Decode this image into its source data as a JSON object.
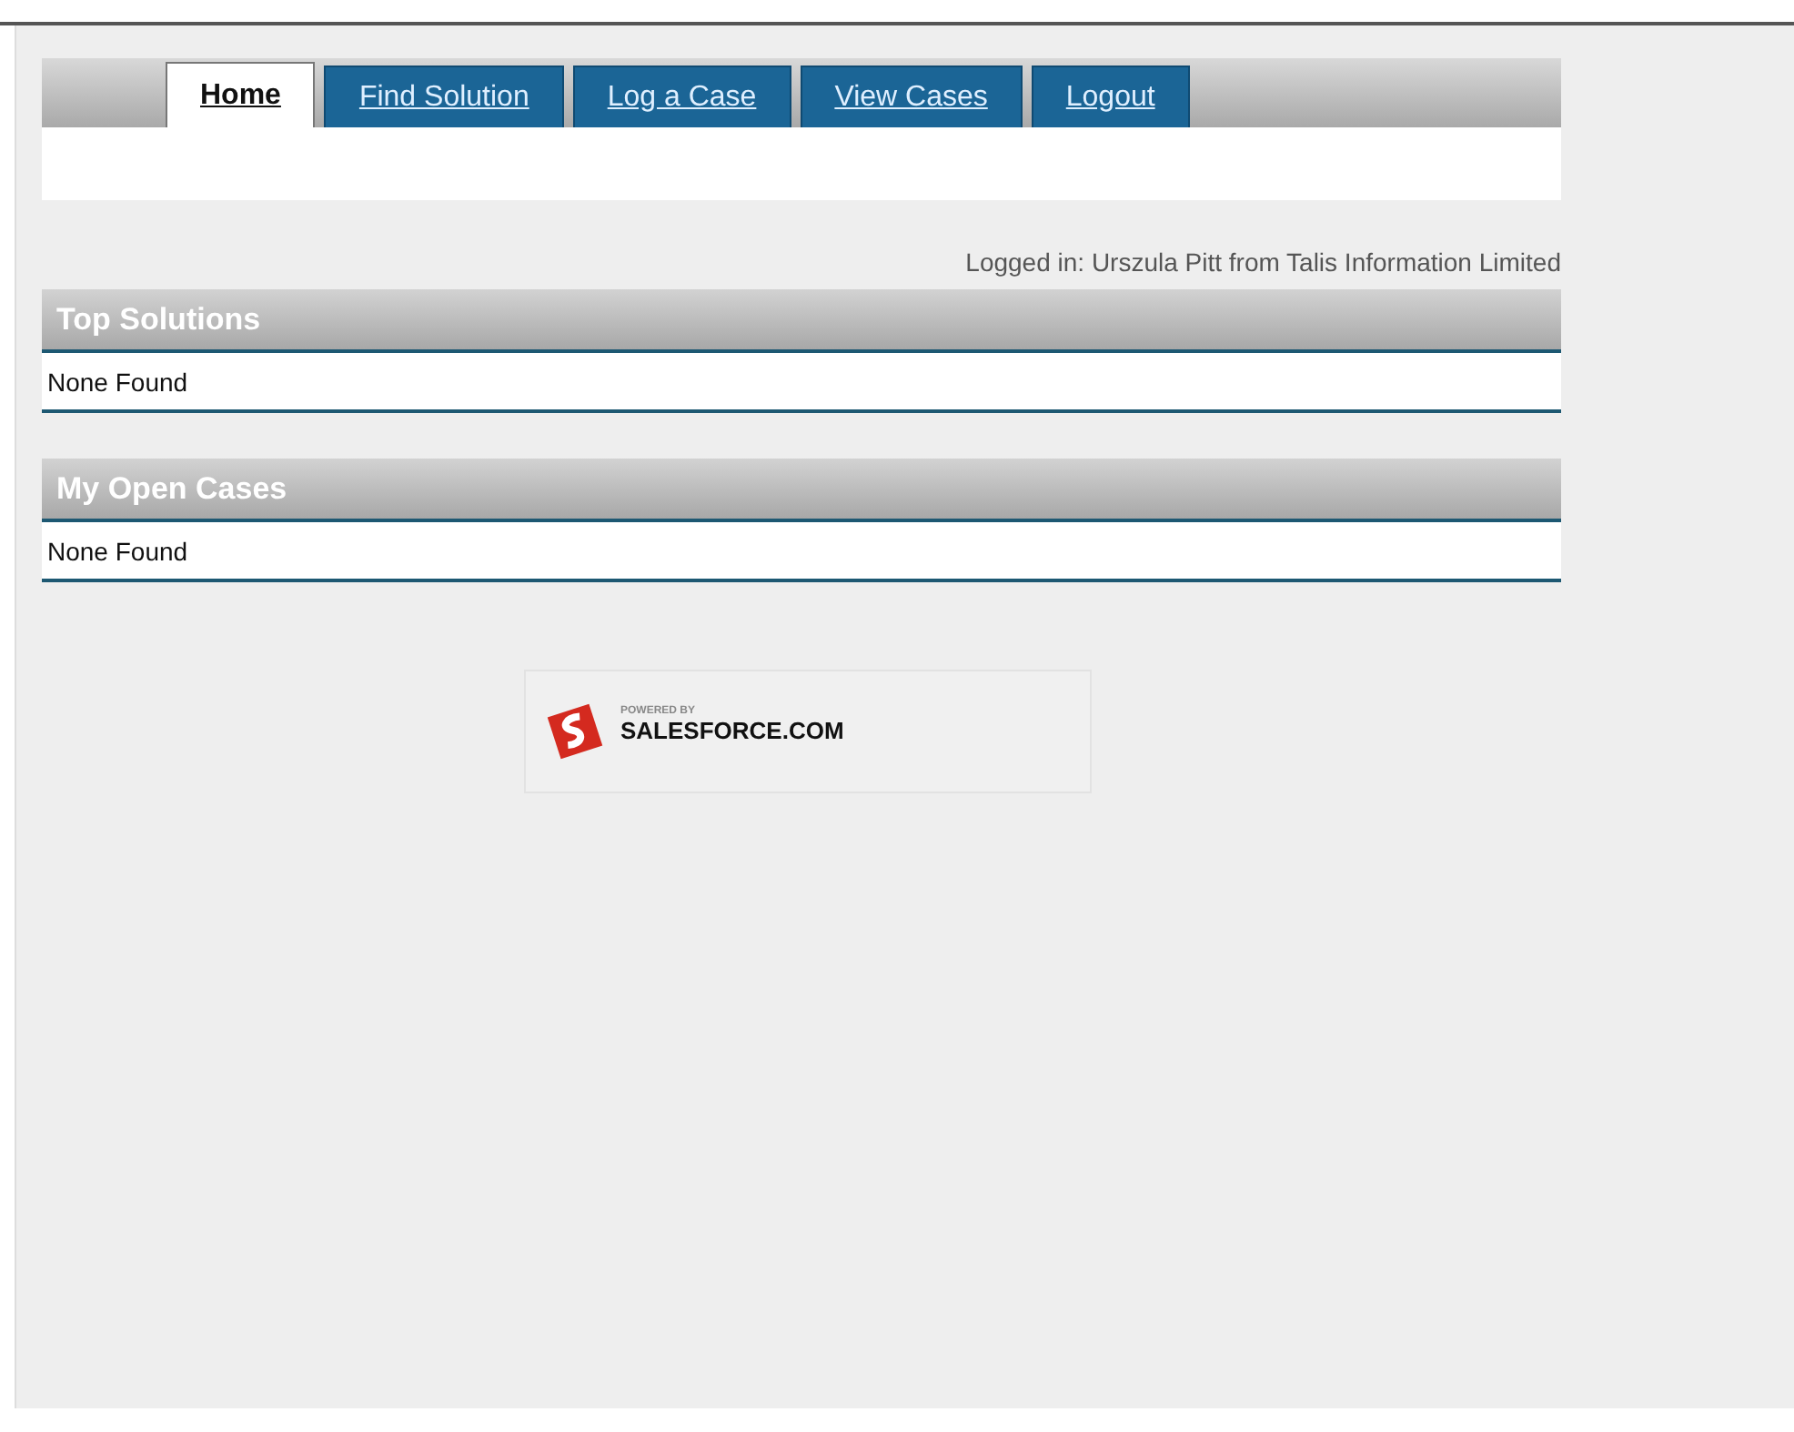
{
  "tabs": [
    {
      "label": "Home",
      "selected": true
    },
    {
      "label": "Find Solution",
      "selected": false
    },
    {
      "label": "Log a Case",
      "selected": false
    },
    {
      "label": "View Cases",
      "selected": false
    },
    {
      "label": "Logout",
      "selected": false
    }
  ],
  "logged_in": "Logged in: Urszula Pitt from Talis Information Limited",
  "sections": [
    {
      "title": "Top Solutions",
      "body": "None Found"
    },
    {
      "title": "My Open Cases",
      "body": "None Found"
    }
  ],
  "badge": {
    "line_1": "POWERED BY",
    "line_2": "SALESFORCE.COM"
  }
}
